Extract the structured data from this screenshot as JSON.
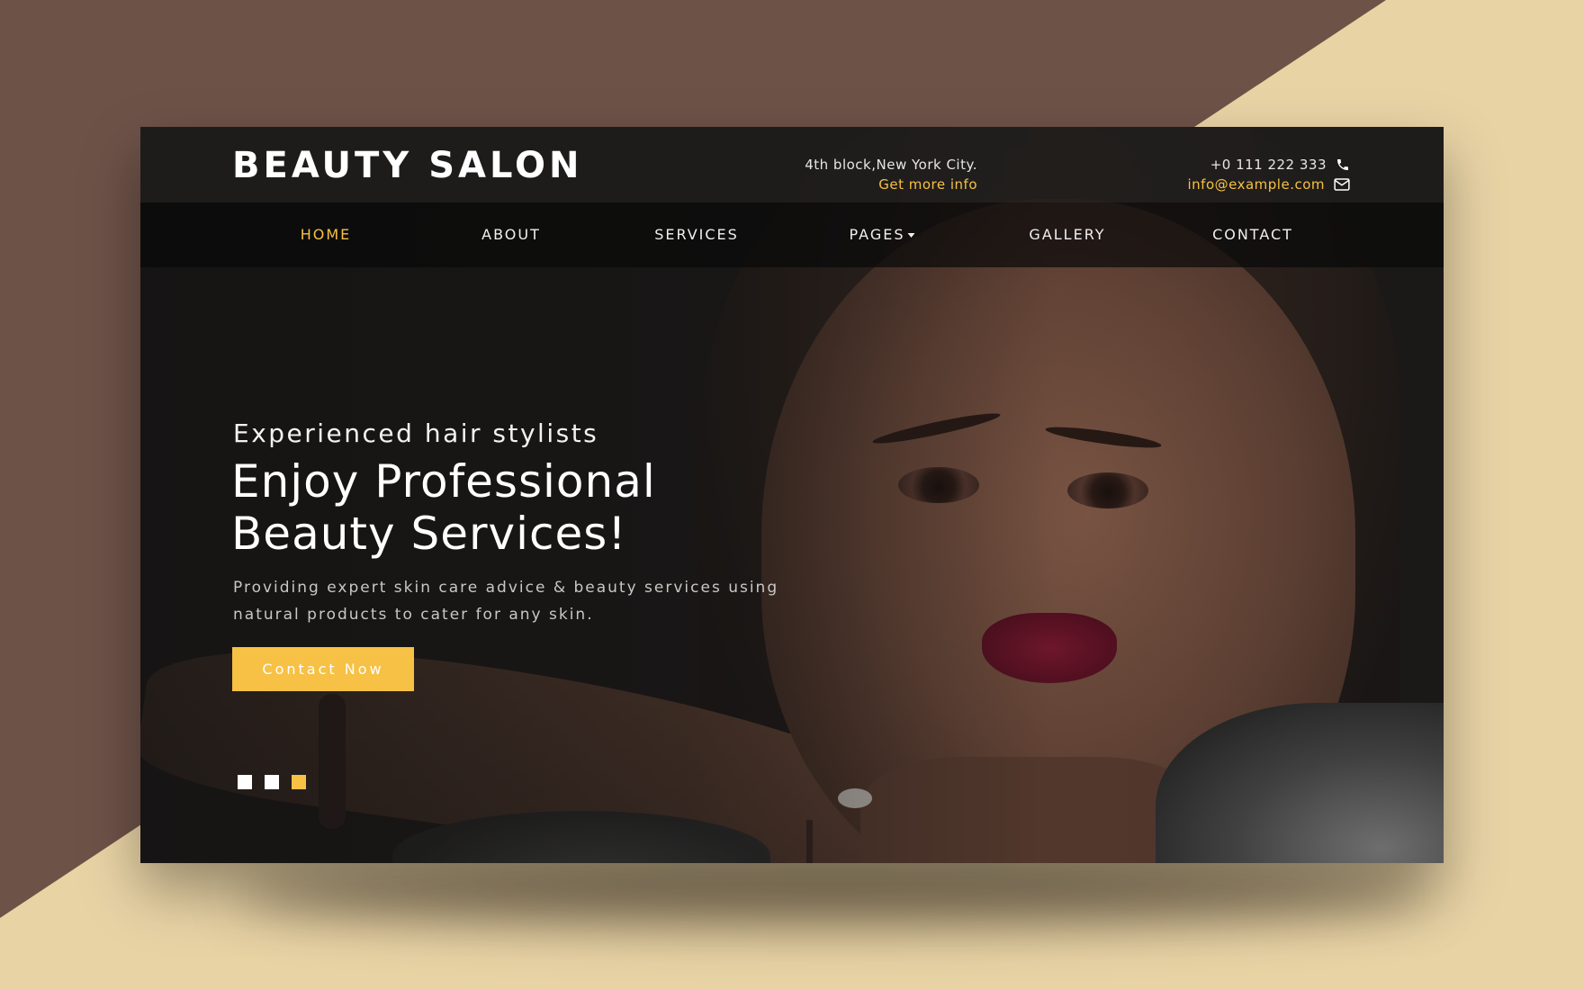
{
  "site": {
    "logo": "BEAUTY SALON"
  },
  "header": {
    "address": "4th block,New York City.",
    "more_info": "Get more info",
    "phone": "+0 111 222 333",
    "email": "info@example.com"
  },
  "nav": {
    "items": [
      {
        "label": "HOME"
      },
      {
        "label": "ABOUT"
      },
      {
        "label": "SERVICES"
      },
      {
        "label": "PAGES"
      },
      {
        "label": "GALLERY"
      },
      {
        "label": "CONTACT"
      }
    ],
    "active_index": 0
  },
  "hero": {
    "eyebrow": "Experienced hair stylists",
    "headline_line1": "Enjoy Professional",
    "headline_line2": "Beauty Services!",
    "description": "Providing expert skin care advice & beauty services using natural products to cater for any skin.",
    "cta_label": "Contact Now",
    "slides_total": 3,
    "slide_active": 3
  },
  "colors": {
    "accent": "#f6c144",
    "page_background_brown": "#6d5248",
    "page_background_cream": "#e8d3a5"
  },
  "icons": {
    "phone": "phone-icon",
    "email": "envelope-icon",
    "dropdown": "caret-down-icon"
  }
}
